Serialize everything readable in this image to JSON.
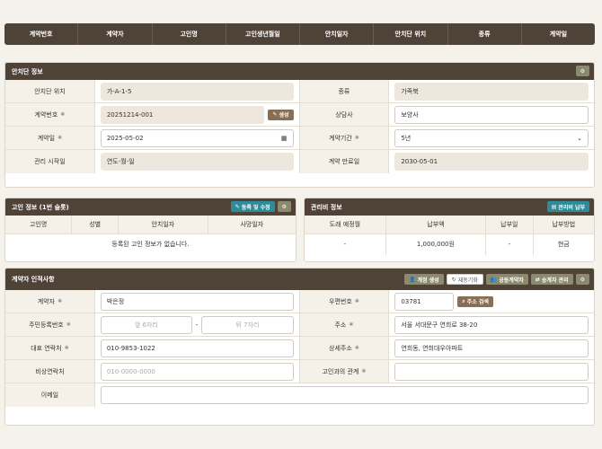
{
  "columns": [
    "계약번호",
    "계약자",
    "고인명",
    "고인생년월일",
    "안치일자",
    "안치단 위치",
    "종류",
    "계약일"
  ],
  "enshrine": {
    "title": "안치단 정보",
    "rows": [
      {
        "l1": "안치단 위치",
        "v1": "가-A-1-5",
        "l2": "종류",
        "v2": "가족북"
      },
      {
        "l1": "계약번호",
        "v1": "20251214-001",
        "gen": "생성",
        "l2": "상담사",
        "v2": "보양사"
      },
      {
        "l1": "계약일",
        "v1": "2025-05-02",
        "l2": "계약기간",
        "v2": "5년"
      },
      {
        "l1": "관리 시작일",
        "v1": "연도-월-일",
        "l2": "계약 만료일",
        "v2": "2030-05-01"
      }
    ]
  },
  "deceased": {
    "title": "고인 정보 (1번 슬롯)",
    "btn": "등록 및 수정",
    "headers": [
      "고인명",
      "성별",
      "안치일자",
      "사망일자"
    ],
    "empty": "등록된 고인 정보가 없습니다."
  },
  "mgmt": {
    "title": "관리비 정보",
    "btn": "관리비 납부",
    "headers": [
      "도래 예정월",
      "납부액",
      "납부일",
      "납부방법"
    ],
    "values": [
      "-",
      "1,000,000원",
      "-",
      "현금"
    ]
  },
  "contractor": {
    "title": "계약자 인적사항",
    "buttons": [
      "계정 생성",
      "재동기화",
      "공동계약자",
      "승계자 관리"
    ],
    "name_label": "계약자",
    "name": "박은정",
    "zip_label": "우편번호",
    "zip": "03781",
    "addr_search": "주소 검색",
    "rrn_label": "주민등록번호",
    "rrn_front_ph": "앞 6자리",
    "rrn_dash": "-",
    "rrn_back_ph": "뒤 7자리",
    "addr_label": "주소",
    "addr": "서울 서대문구 연희로 38-20",
    "phone_label": "대표 연락처",
    "phone": "010-9853-1022",
    "addr2_label": "상세주소",
    "addr2": "연희동, 연희대우아파트",
    "emerg_label": "비상연락처",
    "emerg_ph": "010-0000-0000",
    "rel_label": "고인과의 관계",
    "email_label": "이메일"
  }
}
